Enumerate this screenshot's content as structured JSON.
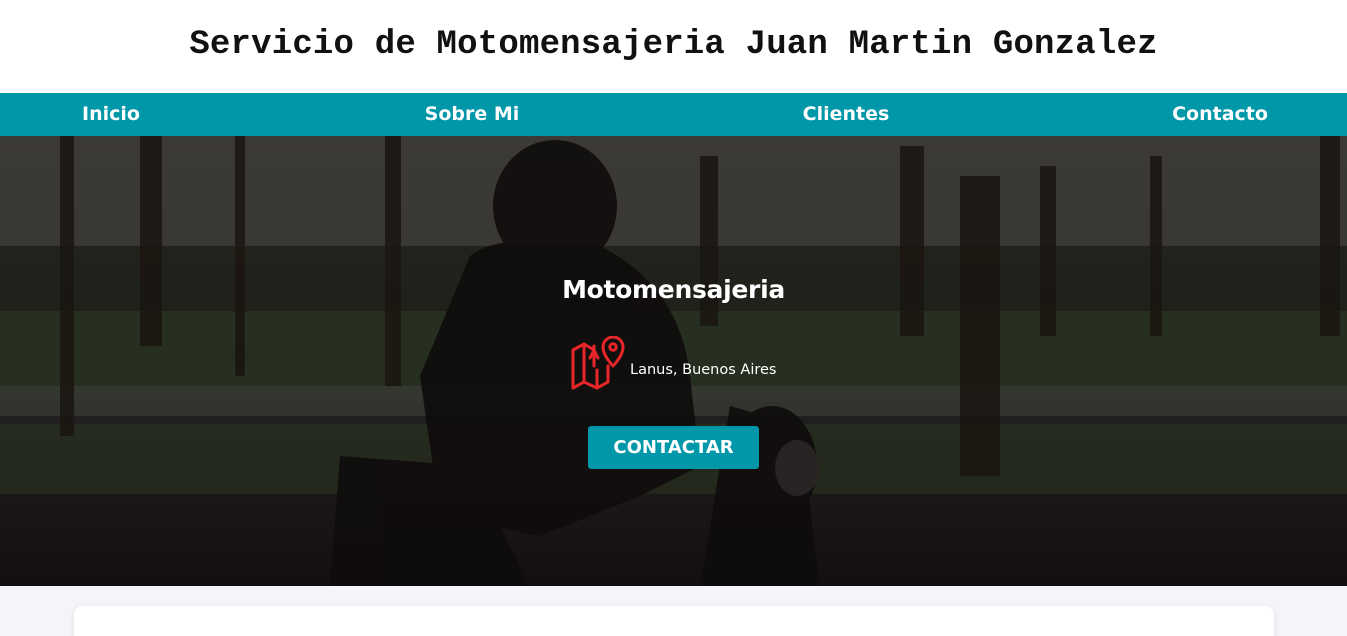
{
  "header": {
    "title": "Servicio de Motomensajeria Juan Martin Gonzalez"
  },
  "nav": {
    "items": [
      {
        "label": "Inicio"
      },
      {
        "label": "Sobre Mi"
      },
      {
        "label": "Clientes"
      },
      {
        "label": "Contacto"
      }
    ]
  },
  "hero": {
    "heading": "Motomensajeria",
    "location_icon": "map-location-icon",
    "location": "Lanus, Buenos Aires",
    "cta_label": "CONTACTAR"
  },
  "colors": {
    "accent": "#0097a8",
    "icon": "#e8262a",
    "background": "#f3f5f9"
  }
}
